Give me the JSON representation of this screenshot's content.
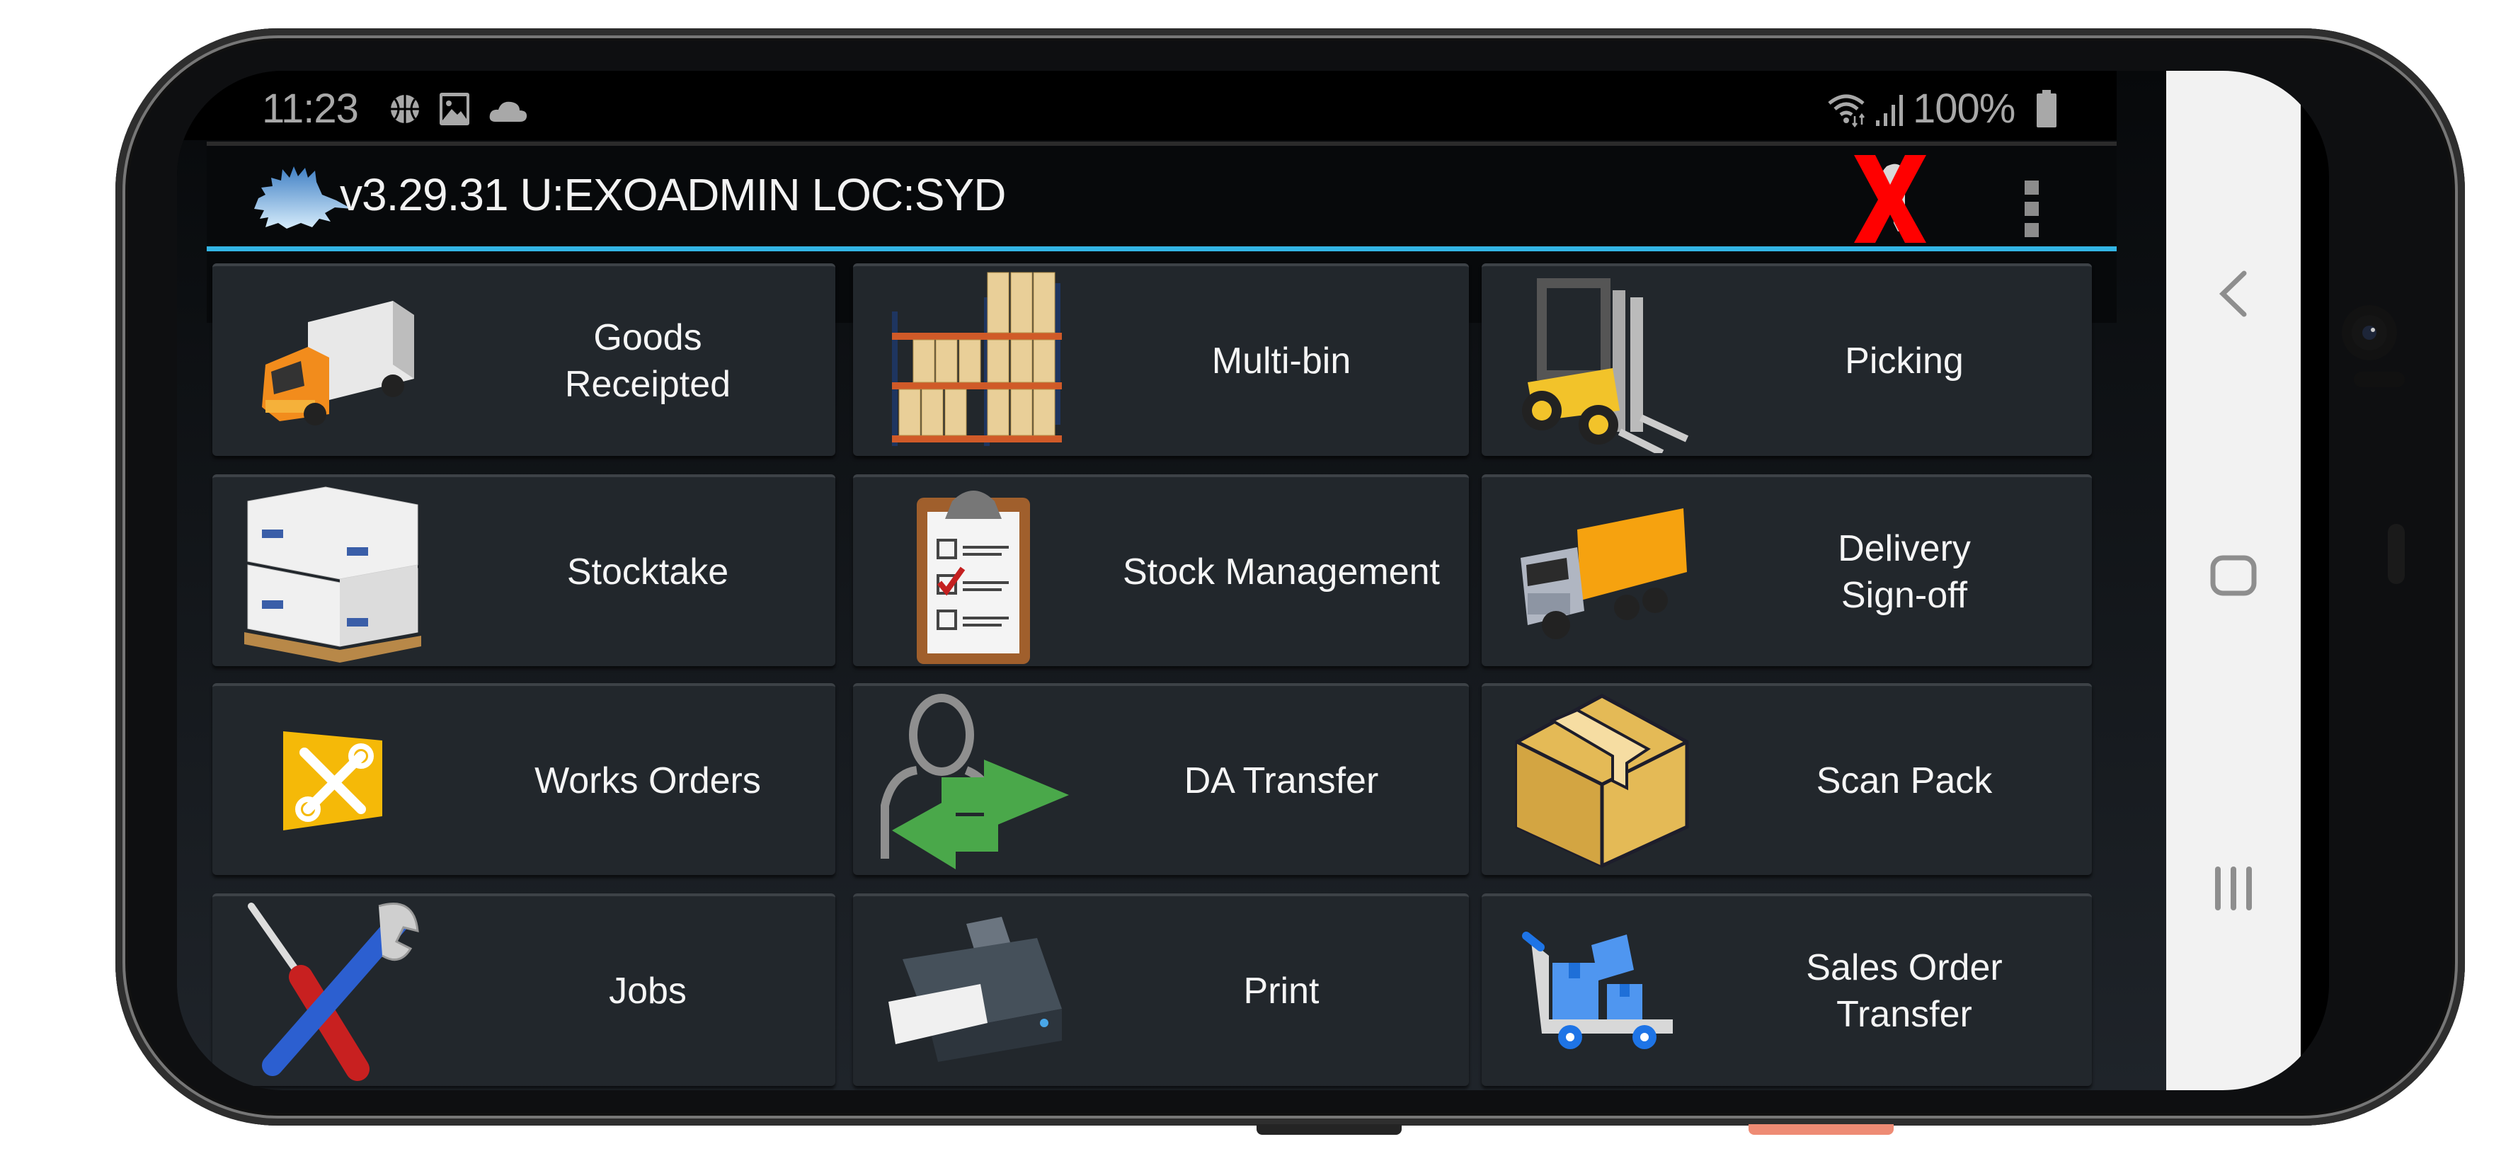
{
  "status_bar": {
    "time": "11:23",
    "left_icons": [
      "basketball-icon",
      "image-icon",
      "cloud-icon"
    ],
    "right_icons": [
      "wifi-icon",
      "signal-icon",
      "battery-icon"
    ],
    "battery": "100%"
  },
  "header": {
    "logo": "echidna-logo",
    "title": "v3.29.31 U:EXOADMIN LOC:SYD",
    "actions": [
      {
        "name": "disconnected-scanner-icon",
        "label": "Scanner disconnected"
      },
      {
        "name": "overflow-menu-icon",
        "label": "More options"
      }
    ],
    "accent_color": "#33b5e5"
  },
  "menu_tiles": [
    {
      "label": "Goods\nReceipted",
      "icon": "truck-icon"
    },
    {
      "label": "Multi-bin",
      "icon": "pallet-rack-icon"
    },
    {
      "label": "Picking",
      "icon": "forklift-icon"
    },
    {
      "label": "Stocktake",
      "icon": "boxes-pallet-icon"
    },
    {
      "label": "Stock Management",
      "icon": "clipboard-checklist-icon"
    },
    {
      "label": "Delivery\nSign-off",
      "icon": "delivery-truck-icon"
    },
    {
      "label": "Works Orders",
      "icon": "tools-badge-icon"
    },
    {
      "label": "DA Transfer",
      "icon": "user-transfer-icon"
    },
    {
      "label": "Scan Pack",
      "icon": "package-box-icon"
    },
    {
      "label": "Jobs",
      "icon": "screwdriver-wrench-icon"
    },
    {
      "label": "Print",
      "icon": "printer-icon"
    },
    {
      "label": "Sales Order\nTransfer",
      "icon": "cart-boxes-icon"
    }
  ],
  "nav_bar": {
    "buttons": [
      {
        "name": "back-button",
        "icon": "chevron-left-icon"
      },
      {
        "name": "home-button",
        "icon": "home-square-icon"
      },
      {
        "name": "recents-button",
        "icon": "recents-icon"
      }
    ]
  }
}
